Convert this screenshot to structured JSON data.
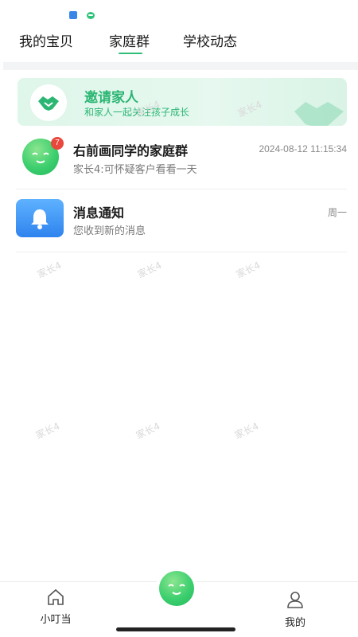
{
  "tabs": [
    {
      "label": "我的宝贝"
    },
    {
      "label": "家庭群"
    },
    {
      "label": "学校动态"
    }
  ],
  "active_tab": "家庭群",
  "invite": {
    "title": "邀请家人",
    "subtitle": "和家人一起关注孩子成长"
  },
  "chats": [
    {
      "title": "右前画同学的家庭群",
      "time": "2024-08-12 11:15:34",
      "preview": "家长4:可怀疑客户看看一天",
      "badge": "7"
    },
    {
      "title": "消息通知",
      "time": "周一",
      "preview": "您收到新的消息"
    }
  ],
  "watermark_text": "家长4",
  "bottom_nav": {
    "home": "小叮当",
    "mine": "我的"
  },
  "colors": {
    "accent": "#2bb673",
    "badge": "#e9483c",
    "notify_blue": "#2f83ee"
  }
}
